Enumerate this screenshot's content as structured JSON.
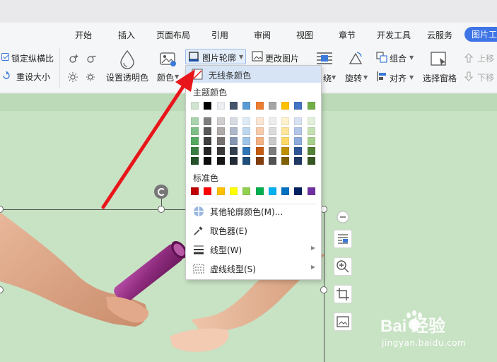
{
  "tabs": [
    "开始",
    "插入",
    "页面布局",
    "引用",
    "审阅",
    "视图",
    "章节",
    "开发工具",
    "云服务",
    "图片工"
  ],
  "ribbon": {
    "lock_ratio": "锁定纵横比",
    "reset_size": "重设大小",
    "set_transparent": "设置透明色",
    "color": "颜色",
    "picture_outline": "图片轮廓",
    "change_picture": "更改图片",
    "wrap": "绕",
    "rotate": "旋转",
    "group": "组合",
    "align": "对齐",
    "selection_pane": "选择窗格",
    "bring_forward": "上移",
    "send_backward": "下移"
  },
  "menu": {
    "no_line_color": "无线条颜色",
    "theme_colors_label": "主题颜色",
    "standard_colors_label": "标准色",
    "more_colors": "其他轮廓颜色(M)...",
    "eyedropper": "取色器(E)",
    "line_style": "线型(W)",
    "dash_style": "虚线线型(S)"
  },
  "theme_colors": {
    "top": [
      "#cfe5d2",
      "#000000",
      "#eceef1",
      "#44546a",
      "#5b9bd5",
      "#ed7d31",
      "#a5a5a5",
      "#ffc000",
      "#4472c4",
      "#70ad47"
    ],
    "shades": [
      [
        "#a8d3ad",
        "#7f7f7f",
        "#d0cece",
        "#d6dce4",
        "#deebf6",
        "#fbe5d5",
        "#ededed",
        "#fff2cc",
        "#d9e2f3",
        "#e2efd9"
      ],
      [
        "#7fbf87",
        "#595959",
        "#aeaaaa",
        "#adb9ca",
        "#bdd7ee",
        "#f8cbad",
        "#dbdbdb",
        "#fee599",
        "#b4c6e7",
        "#c5e0b3"
      ],
      [
        "#55a960",
        "#3f3f3f",
        "#757070",
        "#8496b0",
        "#9dc3e6",
        "#f4b183",
        "#c9c9c9",
        "#ffd965",
        "#8eaadb",
        "#a8d08d"
      ],
      [
        "#3a7d43",
        "#262626",
        "#3a3838",
        "#323f4f",
        "#2e75b5",
        "#c55a11",
        "#7b7b7b",
        "#bf9000",
        "#2f5496",
        "#538135"
      ],
      [
        "#24512a",
        "#0c0c0c",
        "#171616",
        "#222a35",
        "#1e4e79",
        "#833c0b",
        "#525252",
        "#7f6000",
        "#1f3864",
        "#375623"
      ]
    ]
  },
  "standard_colors": [
    "#c00000",
    "#ff0000",
    "#ffc000",
    "#ffff00",
    "#92d050",
    "#00b050",
    "#00b0f0",
    "#0070c0",
    "#002060",
    "#7030a0"
  ],
  "watermark": {
    "brand": "Bai  经验",
    "url": "jingyan.baidu.com"
  },
  "colors": {
    "accent": "#3d74e6",
    "canvas": "#c8e2c4",
    "arrow": "#e8161b",
    "menu_highlight": "#d6e4f6"
  }
}
